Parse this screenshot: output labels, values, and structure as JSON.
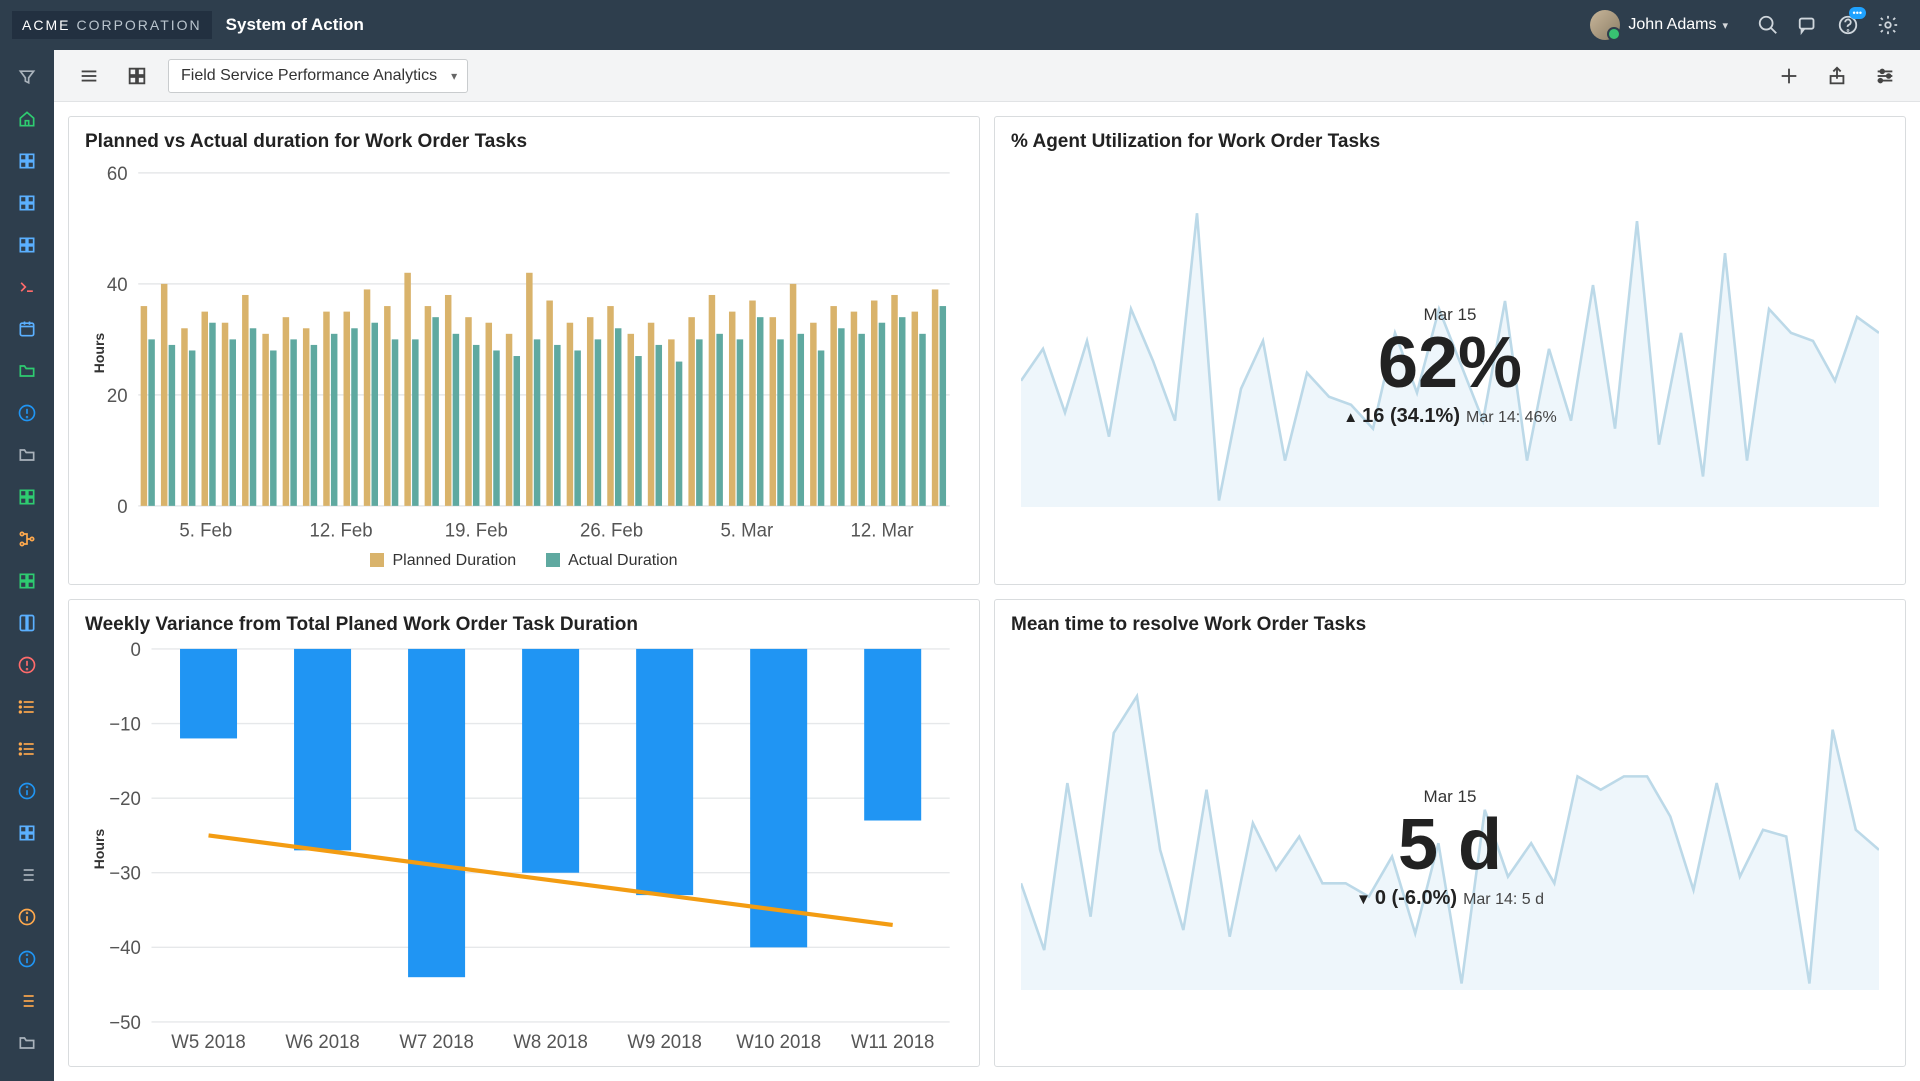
{
  "brand": {
    "strong": "ACME",
    "light": "CORPORATION"
  },
  "system_title": "System of Action",
  "user": {
    "name": "John Adams"
  },
  "toolbar": {
    "selector_label": "Field Service Performance Analytics"
  },
  "cards": {
    "planned_vs_actual": {
      "title": "Planned vs Actual duration for Work Order Tasks",
      "ylabel": "Hours",
      "legend_planned": "Planned Duration",
      "legend_actual": "Actual Duration"
    },
    "agent_util": {
      "title": "% Agent Utilization for Work Order Tasks",
      "date": "Mar 15",
      "value": "62%",
      "delta": "16 (34.1%)",
      "prev": "Mar 14: 46%"
    },
    "weekly_variance": {
      "title": "Weekly Variance from Total Planed Work Order Task Duration",
      "ylabel": "Hours"
    },
    "mttr": {
      "title": "Mean time to resolve Work Order Tasks",
      "date": "Mar 15",
      "value": "5 d",
      "delta": "0 (-6.0%)",
      "prev": "Mar 14: 5 d"
    }
  },
  "colors": {
    "planned": "#d9b36b",
    "actual": "#5fa9a0",
    "variance_bar": "#2095f3",
    "trend_line": "#f39c12",
    "spark": "#bcd9e8",
    "spark_fill": "#eef6fb"
  },
  "chart_data": [
    {
      "id": "planned_vs_actual",
      "type": "bar",
      "ylabel": "Hours",
      "ylim": [
        0,
        60
      ],
      "yticks": [
        0,
        20,
        40,
        60
      ],
      "x_tick_labels": [
        "5. Feb",
        "12. Feb",
        "19. Feb",
        "26. Feb",
        "5. Mar",
        "12. Mar"
      ],
      "series": [
        {
          "name": "Planned Duration",
          "color": "#d9b36b",
          "values": [
            36,
            40,
            32,
            35,
            33,
            38,
            31,
            34,
            32,
            35,
            35,
            39,
            36,
            42,
            36,
            38,
            34,
            33,
            31,
            42,
            37,
            33,
            34,
            36,
            31,
            33,
            30,
            34,
            38,
            35,
            37,
            34,
            40,
            33,
            36,
            35,
            37,
            38,
            35,
            39
          ]
        },
        {
          "name": "Actual Duration",
          "color": "#5fa9a0",
          "values": [
            30,
            29,
            28,
            33,
            30,
            32,
            28,
            30,
            29,
            31,
            32,
            33,
            30,
            30,
            34,
            31,
            29,
            28,
            27,
            30,
            29,
            28,
            30,
            32,
            27,
            29,
            26,
            30,
            31,
            30,
            34,
            30,
            31,
            28,
            32,
            31,
            33,
            34,
            31,
            36
          ]
        }
      ]
    },
    {
      "id": "agent_util",
      "type": "line",
      "title": "% Agent Utilization for Work Order Tasks",
      "stat": {
        "date": "Mar 15",
        "value_pct": 62,
        "delta_abs": 16,
        "delta_pct": 34.1,
        "prev_label": "Mar 14",
        "prev_value_pct": 46
      },
      "spark_values": [
        50,
        58,
        42,
        60,
        36,
        68,
        55,
        40,
        92,
        20,
        48,
        60,
        30,
        52,
        46,
        44,
        38,
        62,
        47,
        68,
        54,
        40,
        70,
        30,
        58,
        40,
        74,
        38,
        90,
        34,
        62,
        26,
        82,
        30,
        68,
        62,
        60,
        50,
        66,
        62
      ]
    },
    {
      "id": "weekly_variance",
      "type": "bar",
      "ylabel": "Hours",
      "ylim": [
        -50,
        0
      ],
      "yticks": [
        0,
        -10,
        -20,
        -30,
        -40,
        -50
      ],
      "categories": [
        "W5 2018",
        "W6 2018",
        "W7 2018",
        "W8 2018",
        "W9 2018",
        "W10 2018",
        "W11 2018"
      ],
      "values": [
        -12,
        -27,
        -44,
        -30,
        -33,
        -40,
        -23
      ],
      "trend": [
        -25,
        -27,
        -29,
        -31,
        -33,
        -35,
        -37
      ]
    },
    {
      "id": "mttr",
      "type": "line",
      "title": "Mean time to resolve Work Order Tasks",
      "stat": {
        "date": "Mar 15",
        "value_days": 5,
        "delta_abs": 0,
        "delta_pct": -6.0,
        "prev_label": "Mar 14",
        "prev_value_days": 5
      },
      "spark_values": [
        40,
        20,
        70,
        30,
        85,
        96,
        50,
        26,
        68,
        24,
        58,
        44,
        54,
        40,
        40,
        36,
        48,
        25,
        52,
        10,
        62,
        42,
        52,
        40,
        72,
        68,
        72,
        72,
        60,
        38,
        70,
        42,
        56,
        54,
        10,
        86,
        56,
        50
      ]
    }
  ]
}
